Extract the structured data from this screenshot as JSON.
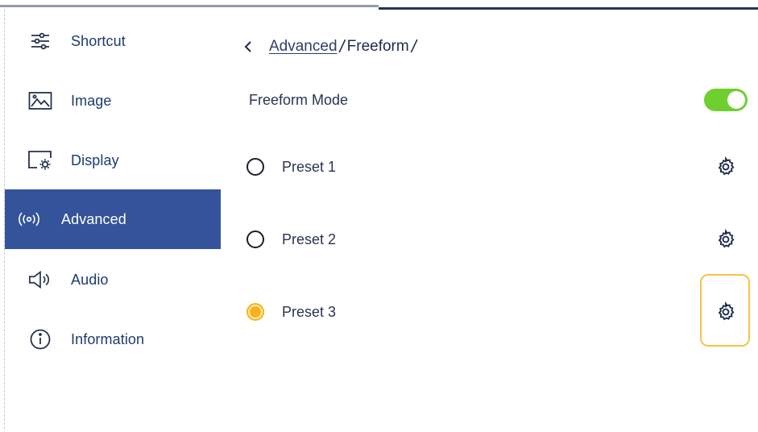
{
  "sidebar": {
    "items": [
      {
        "label": "Shortcut",
        "icon": "sliders-icon",
        "active": false
      },
      {
        "label": "Image",
        "icon": "image-icon",
        "active": false
      },
      {
        "label": "Display",
        "icon": "display-settings-icon",
        "active": false
      },
      {
        "label": "Advanced",
        "icon": "broadcast-icon",
        "active": true
      },
      {
        "label": "Audio",
        "icon": "speaker-icon",
        "active": false
      },
      {
        "label": "Information",
        "icon": "info-icon",
        "active": false
      }
    ]
  },
  "breadcrumb": {
    "back_icon": "chevron-left-icon",
    "parent": "Advanced",
    "current": "Freeform",
    "separator": "/"
  },
  "freeform_mode": {
    "label": "Freeform Mode",
    "enabled": true
  },
  "presets": [
    {
      "label": "Preset 1",
      "selected": false,
      "icon": "gear-icon"
    },
    {
      "label": "Preset 2",
      "selected": false,
      "icon": "gear-icon"
    },
    {
      "label": "Preset 3",
      "selected": true,
      "icon": "gear-icon",
      "focused": true
    }
  ],
  "colors": {
    "active_nav_bg": "#35539a",
    "toggle_on": "#6fcf2f",
    "radio_selected": "#f7b41a",
    "focus_ring": "#f7c24a"
  }
}
